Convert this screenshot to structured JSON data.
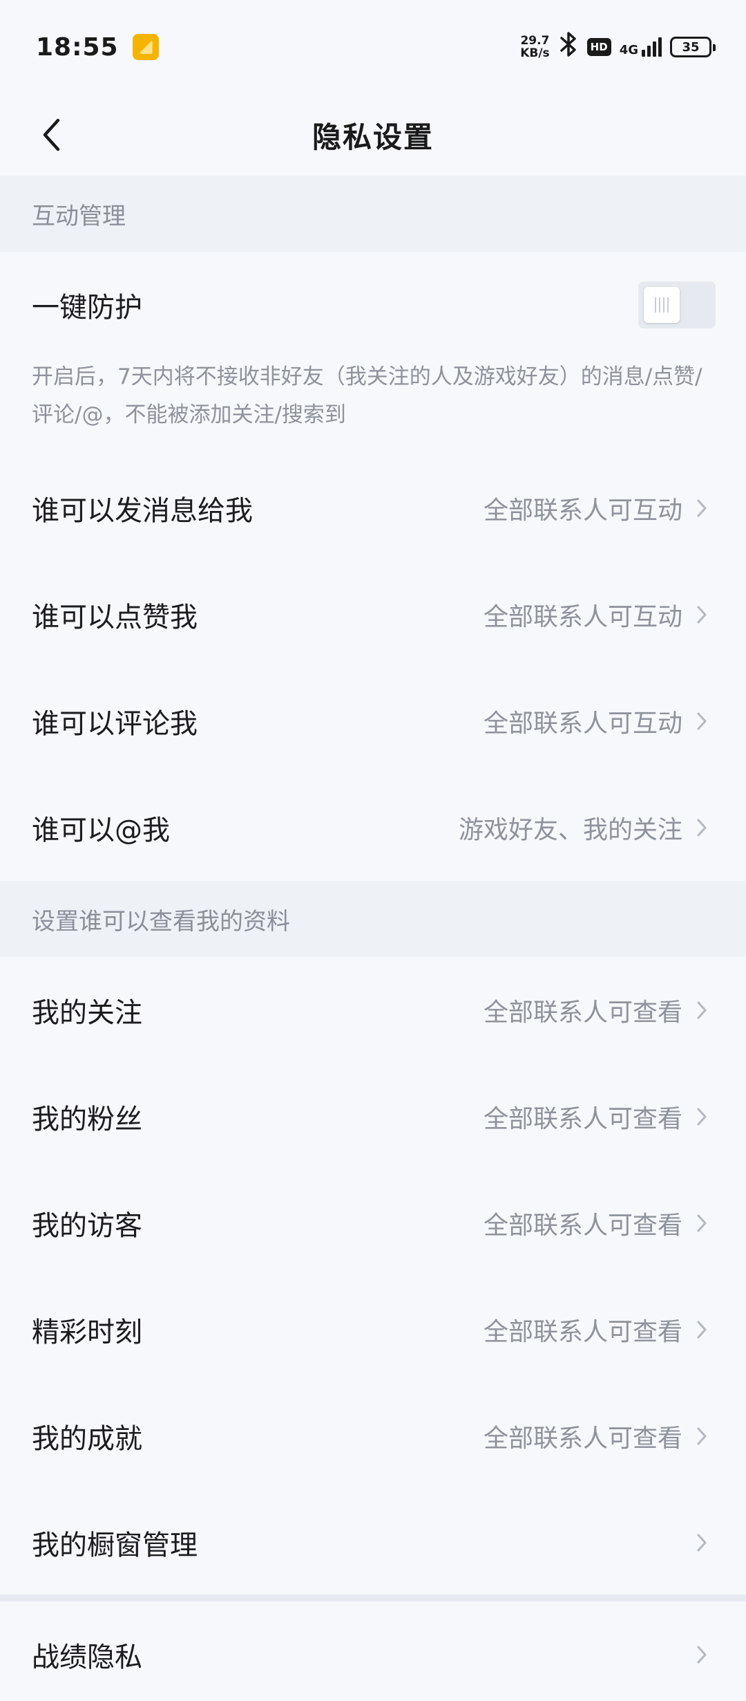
{
  "status_bar": {
    "time": "18:55",
    "speed_value": "29.7",
    "speed_unit": "KB/s",
    "hd": "HD",
    "network": "4G",
    "battery": "35"
  },
  "nav": {
    "title": "隐私设置"
  },
  "interaction": {
    "header": "互动管理",
    "protection_label": "一键防护",
    "protection_on": false,
    "protection_desc": "开启后，7天内将不接收非好友（我关注的人及游戏好友）的消息/点赞/评论/@，不能被添加关注/搜索到",
    "rows": [
      {
        "label": "谁可以发消息给我",
        "value": "全部联系人可互动"
      },
      {
        "label": "谁可以点赞我",
        "value": "全部联系人可互动"
      },
      {
        "label": "谁可以评论我",
        "value": "全部联系人可互动"
      },
      {
        "label": "谁可以@我",
        "value": "游戏好友、我的关注"
      }
    ]
  },
  "profile": {
    "header": "设置谁可以查看我的资料",
    "rows": [
      {
        "label": "我的关注",
        "value": "全部联系人可查看"
      },
      {
        "label": "我的粉丝",
        "value": "全部联系人可查看"
      },
      {
        "label": "我的访客",
        "value": "全部联系人可查看"
      },
      {
        "label": "精彩时刻",
        "value": "全部联系人可查看"
      },
      {
        "label": "我的成就",
        "value": "全部联系人可查看"
      },
      {
        "label": "我的橱窗管理",
        "value": ""
      }
    ]
  },
  "other": {
    "rows": [
      {
        "label": "战绩隐私",
        "value": ""
      }
    ]
  },
  "colors": {
    "background": "#f6f8fc",
    "section_background": "#eef1f6",
    "text_primary": "#1c1c1e",
    "text_secondary": "#8e929b"
  }
}
